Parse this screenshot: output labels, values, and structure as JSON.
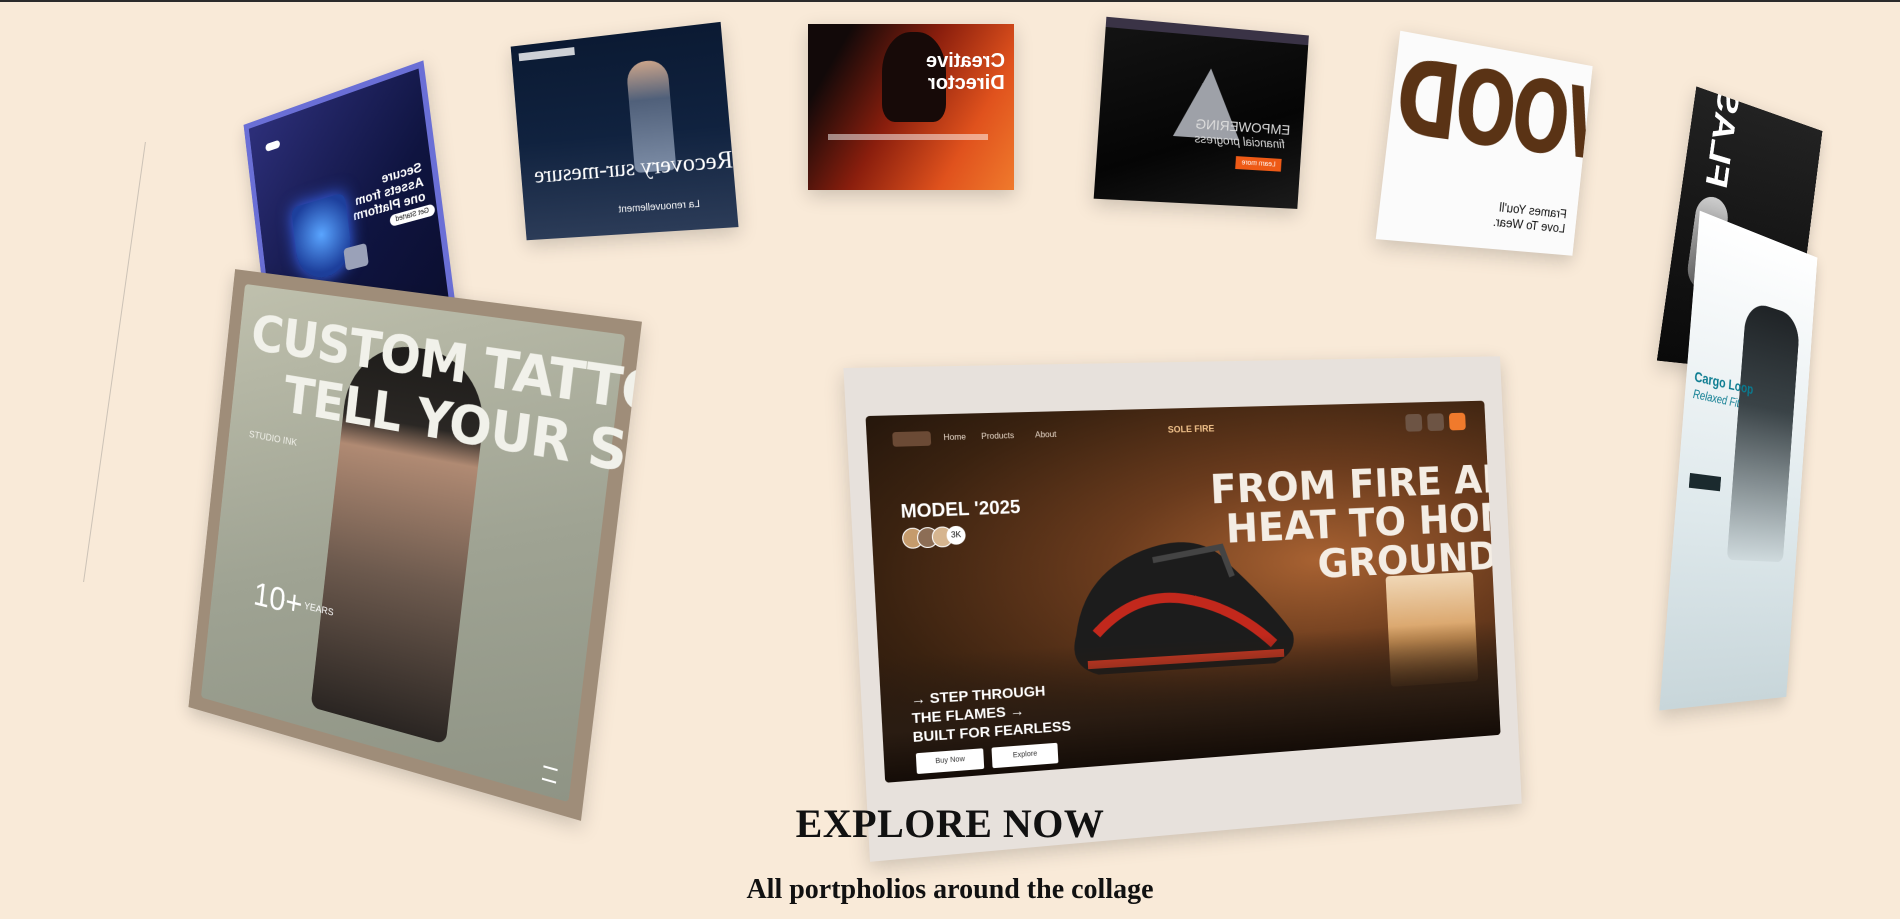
{
  "caption": {
    "title": "EXPLORE NOW",
    "subtitle": "All portpholios around the collage"
  },
  "cards": {
    "secure": {
      "headline": "Secure Assets from one Platform",
      "cta": "Get Started"
    },
    "recovery": {
      "headline": "Recovery sur-mesure",
      "footer": "La renouvellement"
    },
    "creative": {
      "headline_1": "Creative",
      "headline_2": "Director"
    },
    "empower": {
      "headline_1": "EMPOWERING",
      "headline_2": "financial progress",
      "cta": "Learn more"
    },
    "wood": {
      "word": "WOOD",
      "tagline": "Frames You'll Love To Wear."
    },
    "dark": {
      "word": "FLASH"
    },
    "cargo": {
      "headline_1": "Cargo Loop",
      "headline_2": "Relaxed Fit"
    },
    "tattoo": {
      "headline_1": "CUSTOM TATTOOS THAT",
      "headline_2": "TELL YOUR STORY",
      "label": "STUDIO INK",
      "stat": "10+",
      "stat_label": "YEARS"
    },
    "sneaker": {
      "model": "MODEL '2025",
      "badge": "3K",
      "headline_1": "FROM FIRE AND",
      "headline_2": "HEAT TO HOME",
      "headline_3": "GROUNDS",
      "tagline_1": "STEP THROUGH",
      "tagline_2": "THE FLAMES",
      "tagline_3": "BUILT FOR FEARLESS",
      "btn_primary": "Buy Now",
      "btn_secondary": "Explore",
      "nav_1": "Home",
      "nav_2": "Products",
      "nav_3": "About",
      "brand": "SOLE FIRE"
    }
  }
}
